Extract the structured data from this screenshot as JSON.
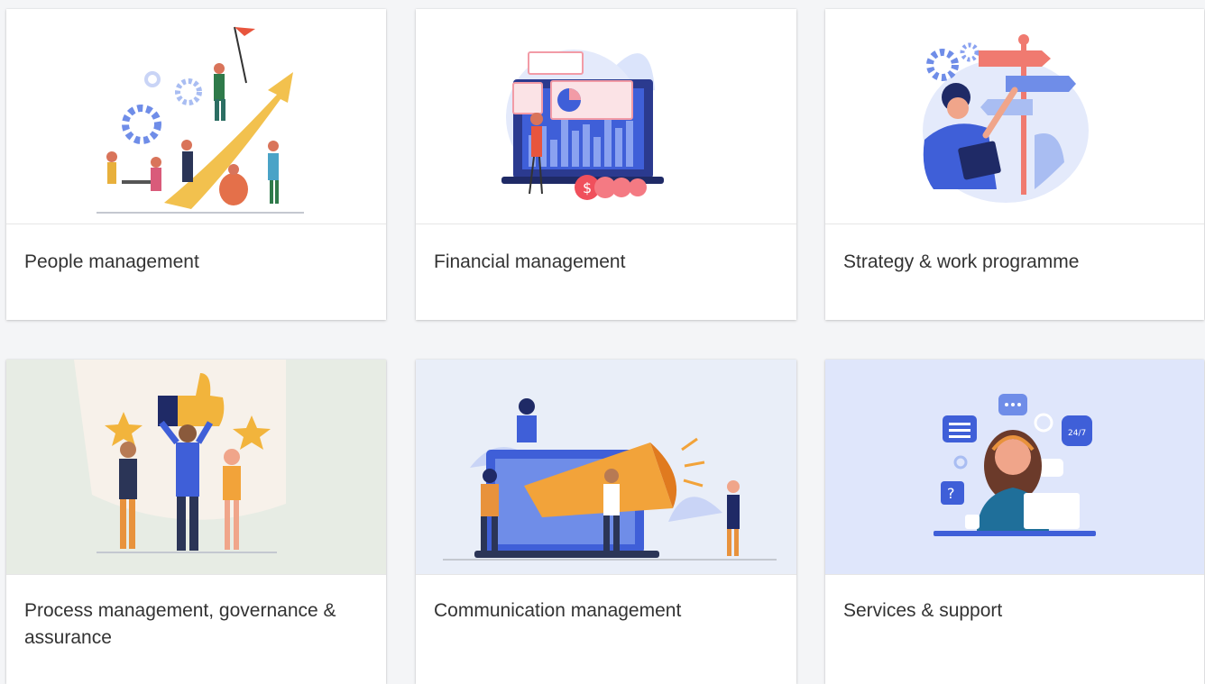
{
  "cards": [
    {
      "title": "People management",
      "illustration": "people-growth-illustration"
    },
    {
      "title": "Financial management",
      "illustration": "finance-dashboard-illustration"
    },
    {
      "title": "Strategy & work programme",
      "illustration": "signpost-strategy-illustration"
    },
    {
      "title": "Process management, governance & assurance",
      "illustration": "thumbs-up-stars-illustration"
    },
    {
      "title": "Communication management",
      "illustration": "megaphone-illustration"
    },
    {
      "title": "Services & support",
      "illustration": "support-agent-illustration"
    }
  ],
  "colors": {
    "card_bg": "#ffffff",
    "page_bg": "#f4f5f7",
    "text": "#333333",
    "accent_orange": "#f2a33a",
    "accent_blue": "#3f5fd8"
  }
}
